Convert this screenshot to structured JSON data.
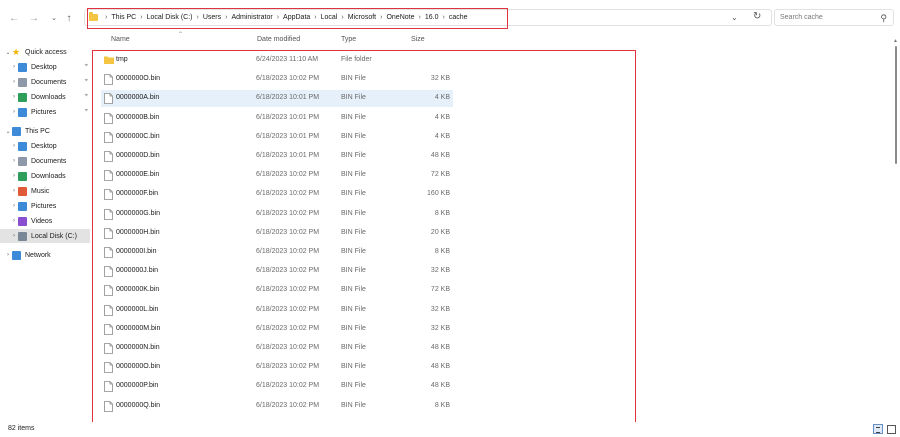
{
  "address": {
    "crumbs": [
      "This PC",
      "Local Disk (C:)",
      "Users",
      "Administrator",
      "AppData",
      "Local",
      "Microsoft",
      "OneNote",
      "16.0",
      "cache"
    ]
  },
  "search": {
    "placeholder": "Search cache"
  },
  "sidebar": {
    "items": [
      {
        "label": "Quick access",
        "icon": "star-icon",
        "level": 0,
        "expanded": true
      },
      {
        "label": "Desktop",
        "icon": "desktop-icon",
        "level": 1,
        "pinned": true
      },
      {
        "label": "Documents",
        "icon": "documents-icon",
        "level": 1,
        "pinned": true
      },
      {
        "label": "Downloads",
        "icon": "downloads-icon",
        "level": 1,
        "pinned": true
      },
      {
        "label": "Pictures",
        "icon": "pictures-icon",
        "level": 1,
        "pinned": true
      },
      {
        "label": "This PC",
        "icon": "computer-icon",
        "level": 0,
        "expanded": true
      },
      {
        "label": "Desktop",
        "icon": "desktop-icon",
        "level": 1
      },
      {
        "label": "Documents",
        "icon": "documents-icon",
        "level": 1
      },
      {
        "label": "Downloads",
        "icon": "downloads-icon",
        "level": 1
      },
      {
        "label": "Music",
        "icon": "music-icon",
        "level": 1
      },
      {
        "label": "Pictures",
        "icon": "pictures-icon",
        "level": 1
      },
      {
        "label": "Videos",
        "icon": "videos-icon",
        "level": 1
      },
      {
        "label": "Local Disk (C:)",
        "icon": "drive-icon",
        "level": 1,
        "selected": true
      },
      {
        "label": "Network",
        "icon": "network-icon",
        "level": 0
      }
    ]
  },
  "columns": {
    "name": "Name",
    "date": "Date modified",
    "type": "Type",
    "size": "Size"
  },
  "files": [
    {
      "name": "tmp",
      "date": "6/24/2023 11:10 AM",
      "type": "File folder",
      "size": "",
      "kind": "folder"
    },
    {
      "name": "0000000O.bin",
      "date": "6/18/2023 10:02 PM",
      "type": "BIN File",
      "size": "32 KB",
      "kind": "file"
    },
    {
      "name": "0000000A.bin",
      "date": "6/18/2023 10:01 PM",
      "type": "BIN File",
      "size": "4 KB",
      "kind": "file",
      "hover": true
    },
    {
      "name": "0000000B.bin",
      "date": "6/18/2023 10:01 PM",
      "type": "BIN File",
      "size": "4 KB",
      "kind": "file"
    },
    {
      "name": "0000000C.bin",
      "date": "6/18/2023 10:01 PM",
      "type": "BIN File",
      "size": "4 KB",
      "kind": "file"
    },
    {
      "name": "0000000D.bin",
      "date": "6/18/2023 10:01 PM",
      "type": "BIN File",
      "size": "48 KB",
      "kind": "file"
    },
    {
      "name": "0000000E.bin",
      "date": "6/18/2023 10:02 PM",
      "type": "BIN File",
      "size": "72 KB",
      "kind": "file"
    },
    {
      "name": "0000000F.bin",
      "date": "6/18/2023 10:02 PM",
      "type": "BIN File",
      "size": "160 KB",
      "kind": "file"
    },
    {
      "name": "0000000G.bin",
      "date": "6/18/2023 10:02 PM",
      "type": "BIN File",
      "size": "8 KB",
      "kind": "file"
    },
    {
      "name": "0000000H.bin",
      "date": "6/18/2023 10:02 PM",
      "type": "BIN File",
      "size": "20 KB",
      "kind": "file"
    },
    {
      "name": "0000000I.bin",
      "date": "6/18/2023 10:02 PM",
      "type": "BIN File",
      "size": "8 KB",
      "kind": "file"
    },
    {
      "name": "0000000J.bin",
      "date": "6/18/2023 10:02 PM",
      "type": "BIN File",
      "size": "32 KB",
      "kind": "file"
    },
    {
      "name": "0000000K.bin",
      "date": "6/18/2023 10:02 PM",
      "type": "BIN File",
      "size": "72 KB",
      "kind": "file"
    },
    {
      "name": "0000000L.bin",
      "date": "6/18/2023 10:02 PM",
      "type": "BIN File",
      "size": "32 KB",
      "kind": "file"
    },
    {
      "name": "0000000M.bin",
      "date": "6/18/2023 10:02 PM",
      "type": "BIN File",
      "size": "32 KB",
      "kind": "file"
    },
    {
      "name": "0000000N.bin",
      "date": "6/18/2023 10:02 PM",
      "type": "BIN File",
      "size": "48 KB",
      "kind": "file"
    },
    {
      "name": "0000000O.bin",
      "date": "6/18/2023 10:02 PM",
      "type": "BIN File",
      "size": "48 KB",
      "kind": "file"
    },
    {
      "name": "0000000P.bin",
      "date": "6/18/2023 10:02 PM",
      "type": "BIN File",
      "size": "48 KB",
      "kind": "file"
    },
    {
      "name": "0000000Q.bin",
      "date": "6/18/2023 10:02 PM",
      "type": "BIN File",
      "size": "8 KB",
      "kind": "file"
    }
  ],
  "status": {
    "count": "82 items"
  },
  "colors": {
    "highlight": "#e0323f",
    "hover_row": "#e6f0fb",
    "selected_nav": "#e3e3e3",
    "folder": "#f4c542"
  }
}
